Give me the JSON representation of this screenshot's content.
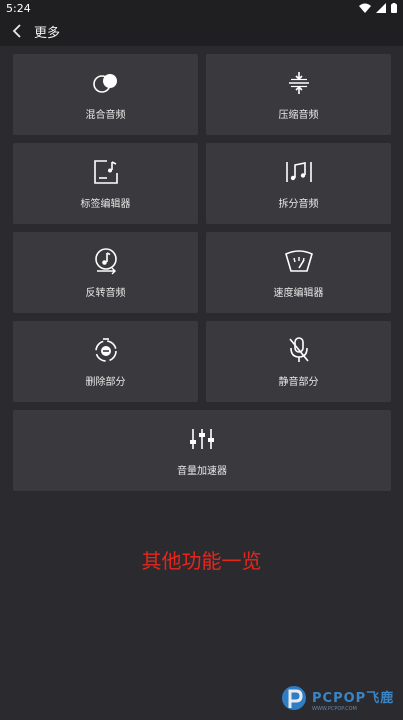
{
  "status": {
    "time": "5:24"
  },
  "app_bar": {
    "title": "更多"
  },
  "tiles": [
    {
      "label": "混合音频",
      "icon": "mix-audio-icon"
    },
    {
      "label": "压缩音频",
      "icon": "compress-audio-icon"
    },
    {
      "label": "标签编辑器",
      "icon": "tag-editor-icon"
    },
    {
      "label": "拆分音频",
      "icon": "split-audio-icon"
    },
    {
      "label": "反转音频",
      "icon": "reverse-audio-icon"
    },
    {
      "label": "速度编辑器",
      "icon": "speed-editor-icon"
    },
    {
      "label": "删除部分",
      "icon": "delete-part-icon"
    },
    {
      "label": "静音部分",
      "icon": "mute-part-icon"
    },
    {
      "label": "音量加速器",
      "icon": "volume-booster-icon"
    }
  ],
  "caption": "其他功能一览",
  "watermark": {
    "text": "PCPOP",
    "suffix": "飞鹿",
    "sub": "WWW.PCPOP.COM"
  },
  "colors": {
    "background": "#2b2b2f",
    "tile": "#3a3a3e",
    "caption": "#e8251c"
  }
}
